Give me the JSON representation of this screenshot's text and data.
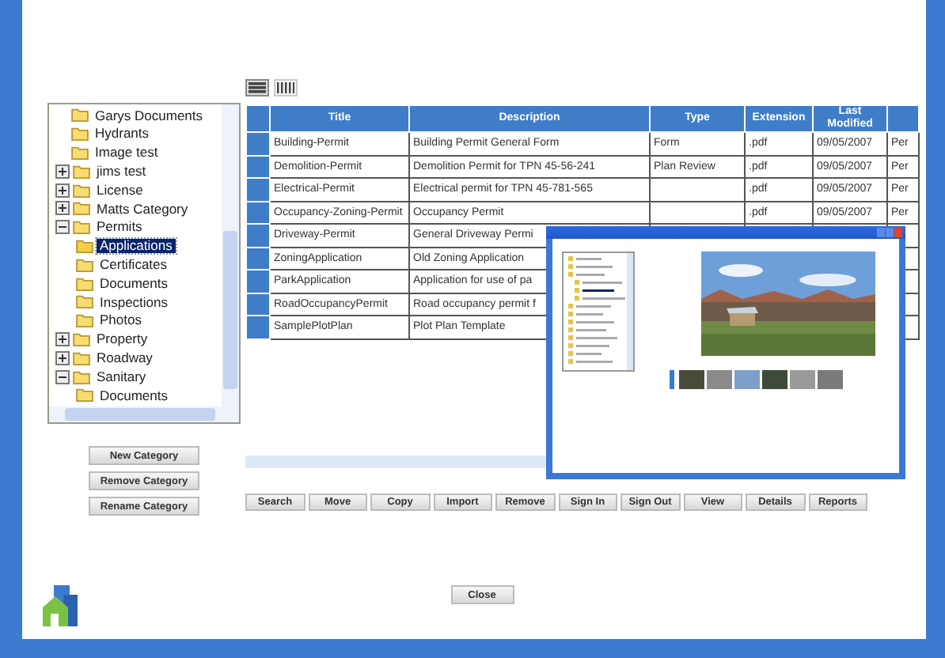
{
  "view_toggle": [
    {
      "selected": true
    },
    {
      "selected": false
    }
  ],
  "tree": [
    {
      "label": "Garys Documents",
      "selected": false
    },
    {
      "label": "Hydrants",
      "selected": false
    },
    {
      "label": "Image test",
      "selected": false
    },
    {
      "label": "jims test",
      "expanded": false,
      "selected": false
    },
    {
      "label": "License",
      "expanded": false,
      "selected": false
    },
    {
      "label": "Matts Category",
      "expanded": false,
      "selected": false
    },
    {
      "label": "Permits",
      "expanded": true,
      "selected": false,
      "children": [
        {
          "label": "Applications",
          "selected": true
        },
        {
          "label": "Certificates",
          "selected": false
        },
        {
          "label": "Documents",
          "selected": false
        },
        {
          "label": "Inspections",
          "selected": false
        },
        {
          "label": "Photos",
          "selected": false
        }
      ]
    },
    {
      "label": "Property",
      "expanded": false,
      "selected": false
    },
    {
      "label": "Roadway",
      "expanded": false,
      "selected": false
    },
    {
      "label": "Sanitary",
      "expanded": true,
      "selected": false,
      "children": [
        {
          "label": "Documents",
          "selected": false
        }
      ]
    }
  ],
  "category_buttons": [
    "New Category",
    "Remove Category",
    "Rename Category"
  ],
  "table": {
    "columns": [
      "Title",
      "Description",
      "Type",
      "Extension",
      "Last Modified"
    ],
    "rows": [
      [
        "Building-Permit",
        "Building Permit General Form",
        "Form",
        ".pdf",
        "09/05/2007",
        "Per"
      ],
      [
        "Demolition-Permit",
        "Demolition Permit for TPN 45-56-241",
        "Plan Review",
        ".pdf",
        "09/05/2007",
        "Per"
      ],
      [
        "Electrical-Permit",
        "Electrical permit for TPN 45-781-565",
        "",
        ".pdf",
        "09/05/2007",
        "Per"
      ],
      [
        "Occupancy-Zoning-Permit",
        "Occupancy Permit",
        "",
        ".pdf",
        "09/05/2007",
        "Per"
      ],
      [
        "Driveway-Permit",
        "General Driveway Permi",
        "",
        "",
        "",
        ""
      ],
      [
        "ZoningApplication",
        "Old Zoning Application",
        "",
        "",
        "",
        ""
      ],
      [
        "ParkApplication",
        "Application for use of pa",
        "",
        "",
        "",
        ""
      ],
      [
        "RoadOccupancyPermit",
        "Road occupancy permit f",
        "",
        "",
        "",
        ""
      ],
      [
        "SamplePlotPlan",
        "Plot Plan Template",
        "",
        "",
        "",
        ""
      ]
    ]
  },
  "actions": [
    "Search",
    "Move",
    "Copy",
    "Import",
    "Remove",
    "Sign In",
    "Sign Out",
    "View",
    "Details",
    "Reports"
  ],
  "close_button": "Close"
}
